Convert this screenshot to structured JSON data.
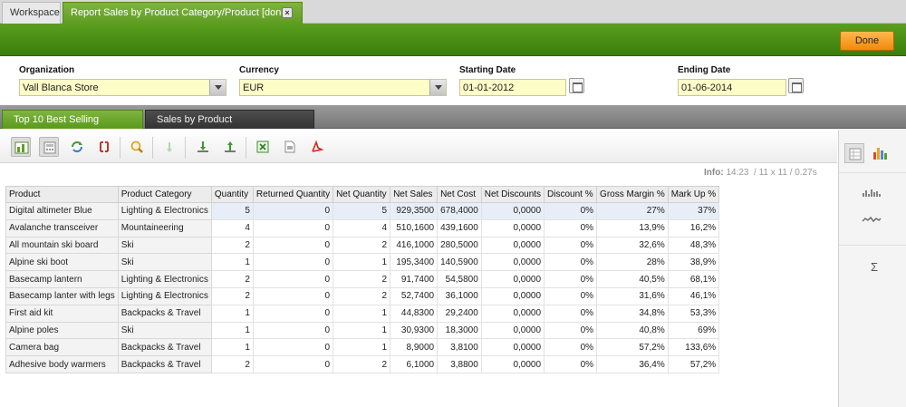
{
  "tabs": {
    "workspace": "Workspace",
    "report": "Report Sales by Product Category/Product [done]"
  },
  "header": {
    "done_label": "Done"
  },
  "filters": {
    "organization": {
      "label": "Organization",
      "value": "Vall Blanca Store"
    },
    "currency": {
      "label": "Currency",
      "value": "EUR"
    },
    "starting_date": {
      "label": "Starting Date",
      "value": "01-01-2012"
    },
    "ending_date": {
      "label": "Ending Date",
      "value": "01-06-2014"
    }
  },
  "section_tabs": {
    "active": "Top 10 Best Selling Products",
    "inactive": "Sales by Product Category/Product"
  },
  "info": {
    "label": "Info:",
    "time": "14:23",
    "dims": "/ 11 x 11",
    "duration": "/ 0.27s"
  },
  "table": {
    "columns": [
      "Product",
      "Product Category",
      "Quantity",
      "Returned Quantity",
      "Net Quantity",
      "Net Sales",
      "Net Cost",
      "Net Discounts",
      "Discount %",
      "Gross Margin %",
      "Mark Up %"
    ],
    "rows": [
      [
        "Digital altimeter Blue",
        "Lighting & Electronics",
        "5",
        "0",
        "5",
        "929,3500",
        "678,4000",
        "0,0000",
        "0%",
        "27%",
        "37%"
      ],
      [
        "Avalanche transceiver",
        "Mountaineering",
        "4",
        "0",
        "4",
        "510,1600",
        "439,1600",
        "0,0000",
        "0%",
        "13,9%",
        "16,2%"
      ],
      [
        "All mountain ski board",
        "Ski",
        "2",
        "0",
        "2",
        "416,1000",
        "280,5000",
        "0,0000",
        "0%",
        "32,6%",
        "48,3%"
      ],
      [
        "Alpine ski boot",
        "Ski",
        "1",
        "0",
        "1",
        "195,3400",
        "140,5900",
        "0,0000",
        "0%",
        "28%",
        "38,9%"
      ],
      [
        "Basecamp lantern",
        "Lighting & Electronics",
        "2",
        "0",
        "2",
        "91,7400",
        "54,5800",
        "0,0000",
        "0%",
        "40,5%",
        "68,1%"
      ],
      [
        "Basecamp lanter with legs",
        "Lighting & Electronics",
        "2",
        "0",
        "2",
        "52,7400",
        "36,1000",
        "0,0000",
        "0%",
        "31,6%",
        "46,1%"
      ],
      [
        "First aid kit",
        "Backpacks & Travel",
        "1",
        "0",
        "1",
        "44,8300",
        "29,2400",
        "0,0000",
        "0%",
        "34,8%",
        "53,3%"
      ],
      [
        "Alpine poles",
        "Ski",
        "1",
        "0",
        "1",
        "30,9300",
        "18,3000",
        "0,0000",
        "0%",
        "40,8%",
        "69%"
      ],
      [
        "Camera bag",
        "Backpacks & Travel",
        "1",
        "0",
        "1",
        "8,9000",
        "3,8100",
        "0,0000",
        "0%",
        "57,2%",
        "133,6%"
      ],
      [
        "Adhesive body warmers",
        "Backpacks & Travel",
        "2",
        "0",
        "2",
        "6,1000",
        "3,8800",
        "0,0000",
        "0%",
        "36,4%",
        "57,2%"
      ]
    ]
  },
  "right_panel": {
    "sum_symbol": "Σ"
  },
  "icons": [
    "tree-icon",
    "calc-icon",
    "refresh-icon",
    "swap-axes-icon",
    "zoom-icon",
    "drill-icon",
    "export-down-icon",
    "export-up-icon",
    "excel-icon",
    "csv-icon",
    "pdf-icon",
    "table-view-icon",
    "bar-chart-icon",
    "sparkbar-icon",
    "sparkline-icon",
    "sum-icon"
  ]
}
